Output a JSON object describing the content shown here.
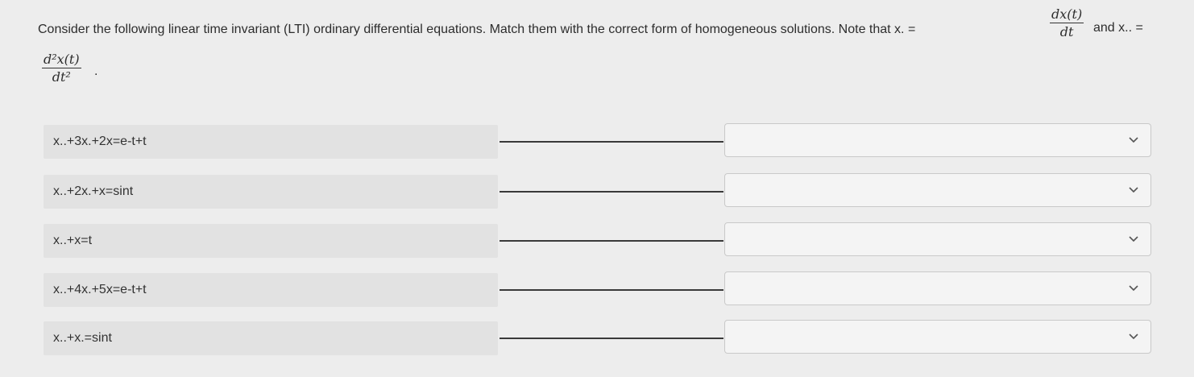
{
  "question": {
    "text": "Consider the following linear time invariant (LTI) ordinary differential equations. Match them with the correct form of homogeneous solutions. Note that x. =",
    "frac1_num": "dx(t)",
    "frac1_den": "dt",
    "and_text": "and x.. =",
    "frac2_num": "d²x(t)",
    "frac2_den": "dt²",
    "period": "."
  },
  "rows": [
    {
      "equation": "x..+3x.+2x=e-t+t",
      "selected": ""
    },
    {
      "equation": "x..+2x.+x=sint",
      "selected": ""
    },
    {
      "equation": "x..+x=t",
      "selected": ""
    },
    {
      "equation": "x..+4x.+5x=e-t+t",
      "selected": ""
    },
    {
      "equation": "x..+x.=sint",
      "selected": ""
    }
  ],
  "icons": {
    "dropdown": "chevron-down-icon"
  }
}
